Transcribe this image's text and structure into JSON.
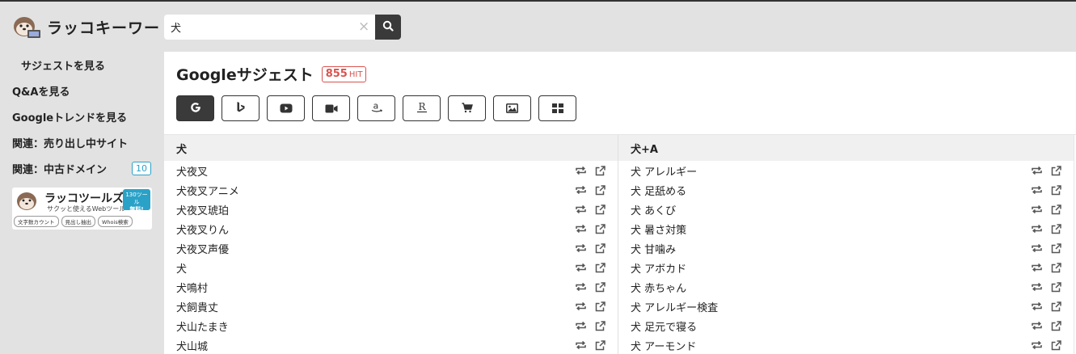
{
  "header": {
    "logo_text": "ラッコキーワード",
    "search": {
      "value": "犬",
      "placeholder": ""
    },
    "clear_symbol": "×"
  },
  "sidebar": {
    "items": [
      {
        "label": "サジェストを見る",
        "active": true
      },
      {
        "label": "Q&Aを見る"
      },
      {
        "label": "Googleトレンドを見る"
      },
      {
        "label": "関連：売り出し中サイト"
      },
      {
        "label": "関連：中古ドメイン",
        "badge": "10"
      }
    ],
    "banner": {
      "title": "ラッコツールズ",
      "subtitle": "サクッと使えるWebツール",
      "badge_line1": "130ツール",
      "badge_line2": "無料!",
      "tags": [
        "文字数カウント",
        "見出し抽出",
        "Whois検索"
      ]
    }
  },
  "main": {
    "title": "Googleサジェスト",
    "hit_count": "855",
    "hit_label": "HIT",
    "engine_tabs": [
      {
        "icon": "google-icon",
        "active": true
      },
      {
        "icon": "bing-icon"
      },
      {
        "icon": "youtube-icon"
      },
      {
        "icon": "video-camera-icon"
      },
      {
        "icon": "amazon-icon"
      },
      {
        "icon": "rakuten-icon"
      },
      {
        "icon": "shopping-cart-icon"
      },
      {
        "icon": "image-icon"
      },
      {
        "icon": "grid-icon"
      }
    ],
    "columns": [
      {
        "header": "犬",
        "items": [
          "犬夜叉",
          "犬夜叉アニメ",
          "犬夜叉琥珀",
          "犬夜叉りん",
          "犬夜叉声優",
          "犬",
          "犬鳴村",
          "犬飼貴丈",
          "犬山たまき",
          "犬山城"
        ]
      },
      {
        "header": "犬+A",
        "items": [
          "犬 アレルギー",
          "犬 足舐める",
          "犬 あくび",
          "犬 暑さ対策",
          "犬 甘噛み",
          "犬 アボカド",
          "犬 赤ちゃん",
          "犬 アレルギー検査",
          "犬 足元で寝る",
          "犬 アーモンド"
        ]
      }
    ]
  },
  "colors": {
    "accent_dark": "#3a3a3a",
    "hit_red": "#d9534f",
    "badge_blue": "#2aa2c8",
    "icon_gray": "#555555"
  }
}
